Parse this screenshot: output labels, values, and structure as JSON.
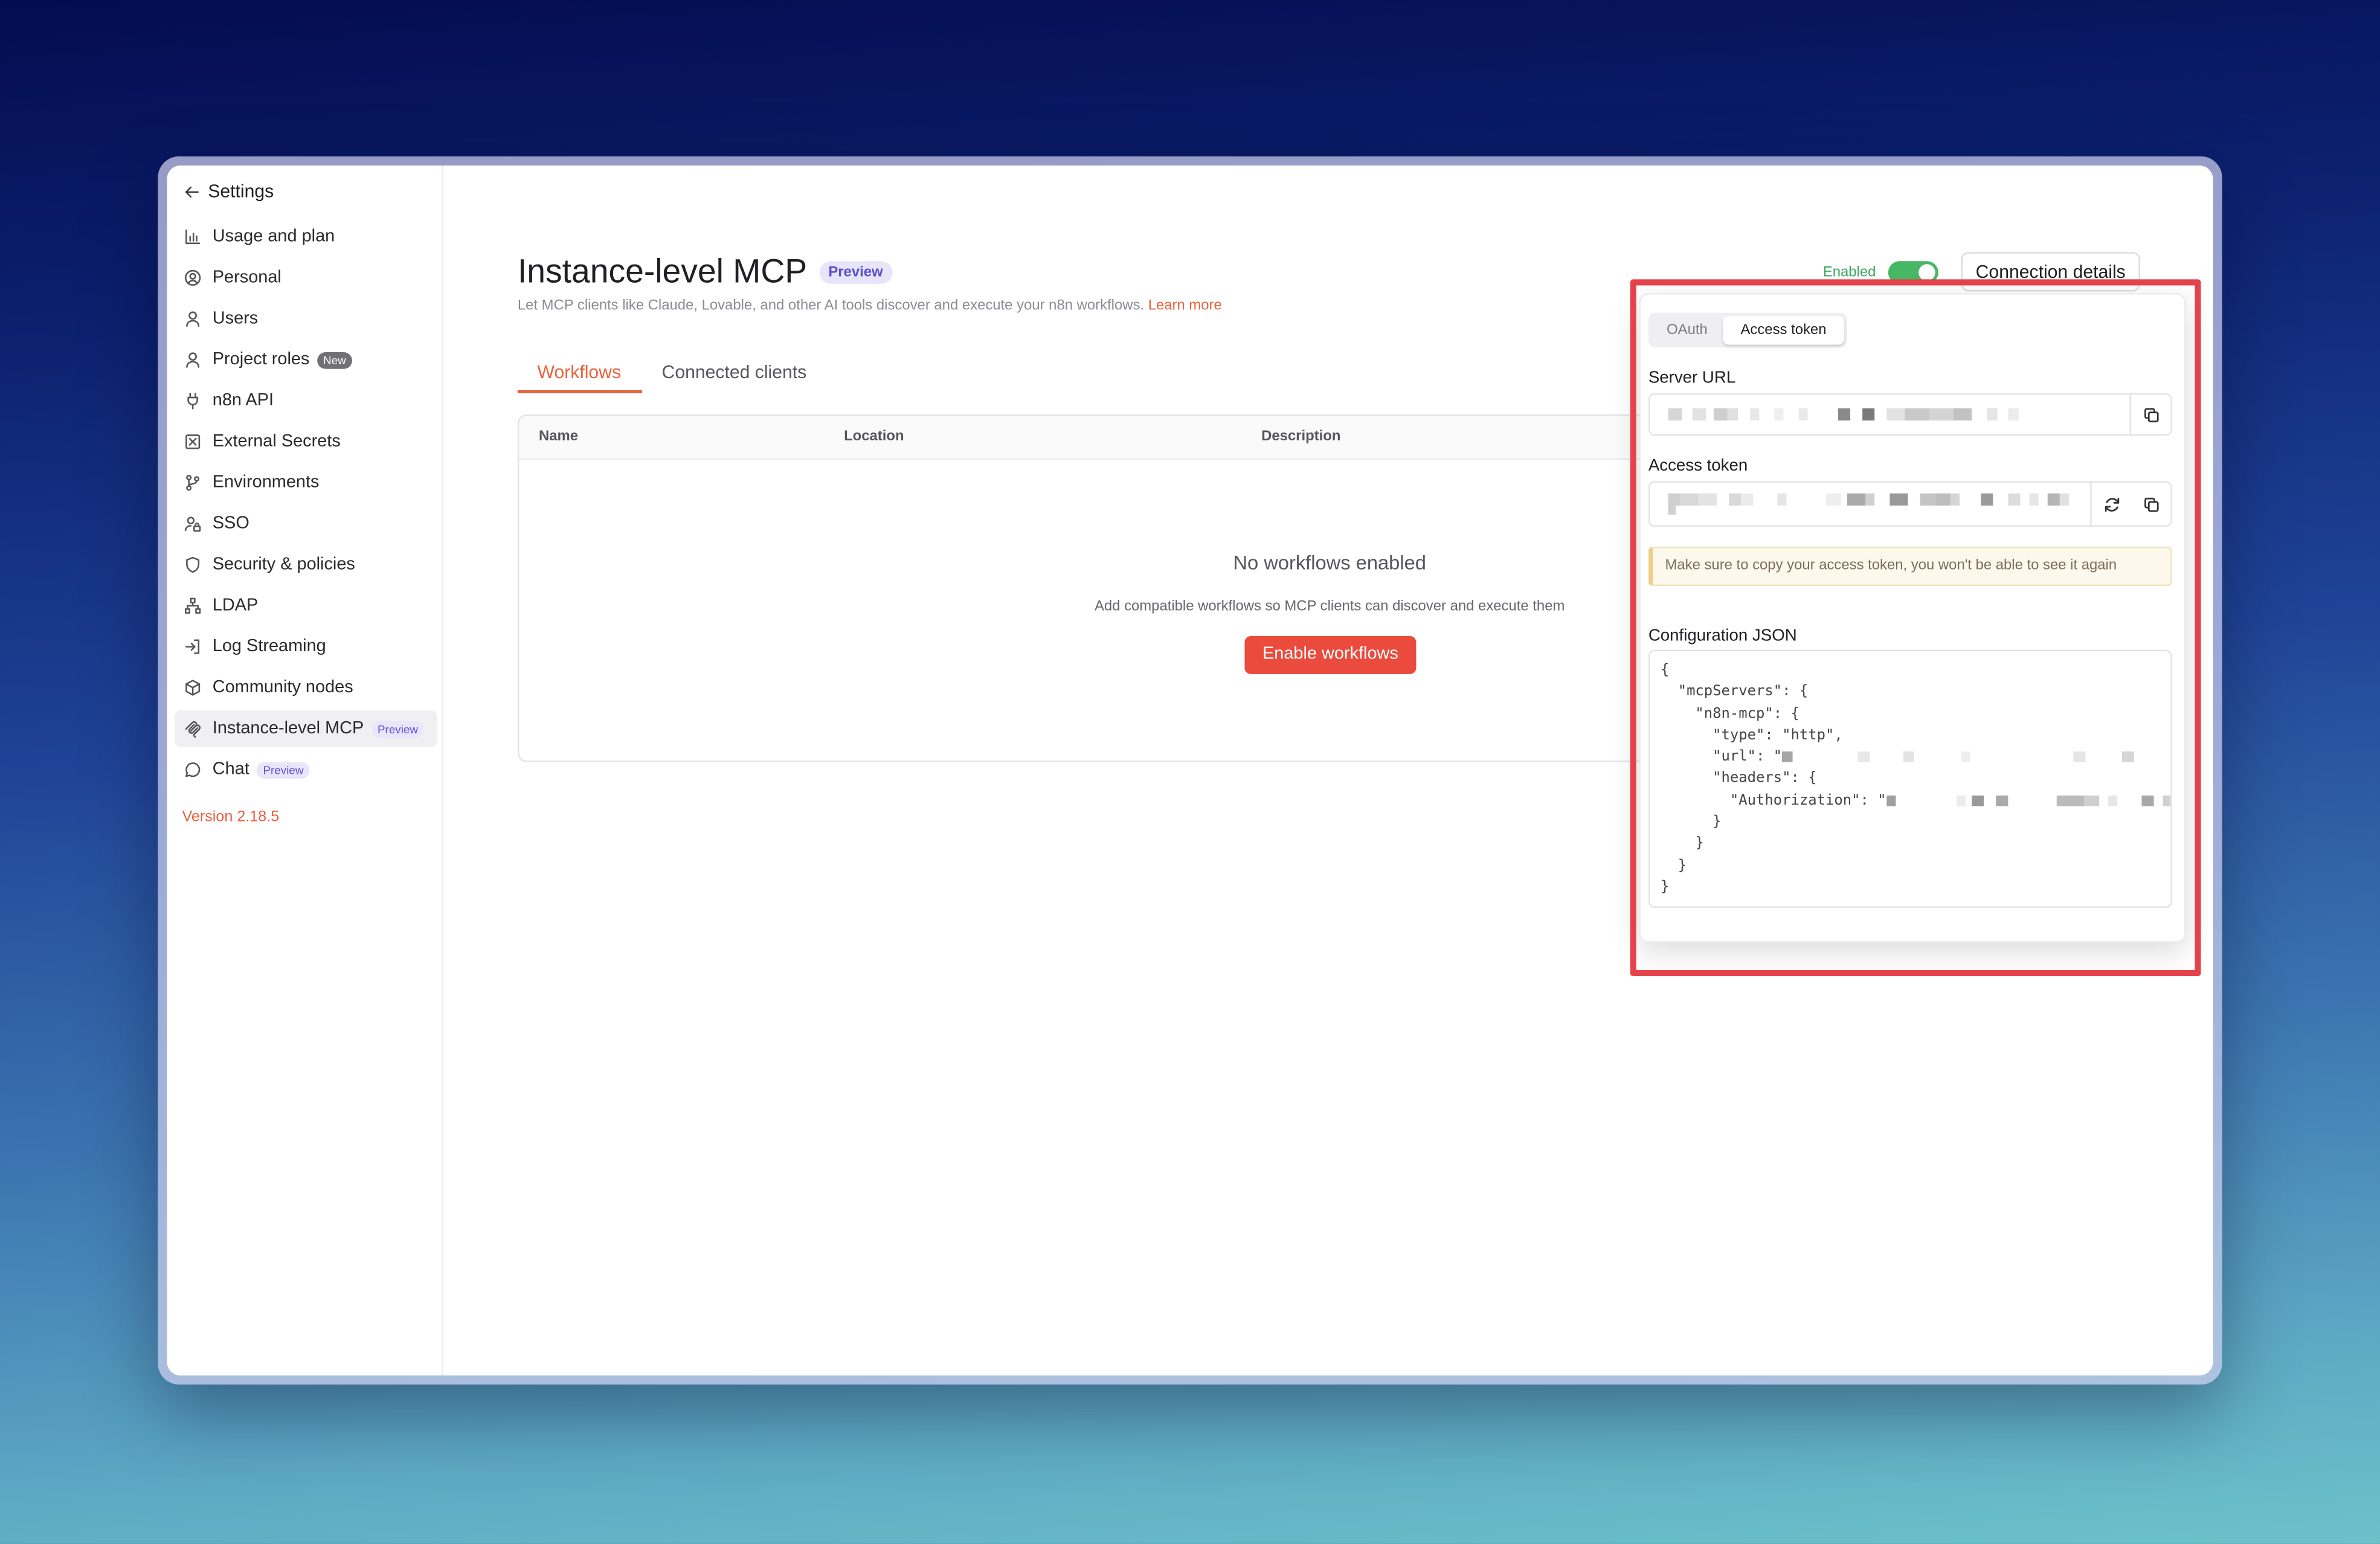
{
  "sidebar": {
    "back_label": "Settings",
    "back_icon": "arrow-left-icon",
    "items": [
      {
        "label": "Usage and plan",
        "icon": "chart-bar-icon"
      },
      {
        "label": "Personal",
        "icon": "user-circle-icon"
      },
      {
        "label": "Users",
        "icon": "user-icon"
      },
      {
        "label": "Project roles",
        "icon": "user-icon",
        "badge": "New"
      },
      {
        "label": "n8n API",
        "icon": "plug-icon"
      },
      {
        "label": "External Secrets",
        "icon": "vault-icon"
      },
      {
        "label": "Environments",
        "icon": "git-branch-icon"
      },
      {
        "label": "SSO",
        "icon": "user-lock-icon"
      },
      {
        "label": "Security & policies",
        "icon": "shield-icon"
      },
      {
        "label": "LDAP",
        "icon": "network-icon"
      },
      {
        "label": "Log Streaming",
        "icon": "sign-in-icon"
      },
      {
        "label": "Community nodes",
        "icon": "cube-icon"
      },
      {
        "label": "Instance-level MCP",
        "icon": "mcp-icon",
        "badge": "Preview",
        "active": true
      },
      {
        "label": "Chat",
        "icon": "chat-icon",
        "badge": "Preview"
      }
    ],
    "version": "Version 2.18.5"
  },
  "header": {
    "title": "Instance-level MCP",
    "badge": "Preview",
    "description": "Let MCP clients like Claude, Lovable, and other AI tools discover and execute your n8n workflows.",
    "learn_more": "Learn more",
    "enabled_label": "Enabled",
    "enabled": true,
    "connection_button": "Connection details"
  },
  "tabs": [
    {
      "label": "Workflows",
      "active": true
    },
    {
      "label": "Connected clients",
      "active": false
    }
  ],
  "table": {
    "columns": [
      "Name",
      "Location",
      "Description"
    ],
    "empty_title": "No workflows enabled",
    "empty_text": "Add compatible workflows so MCP clients can discover and execute them",
    "empty_button": "Enable workflows"
  },
  "connection_panel": {
    "auth_tabs": [
      {
        "label": "OAuth",
        "active": false
      },
      {
        "label": "Access token",
        "active": true
      }
    ],
    "server_url_label": "Server URL",
    "access_token_label": "Access token",
    "warning": "Make sure to copy your access token, you won't be able to see it again",
    "config_label": "Configuration JSON",
    "config_lines": [
      "{",
      "  \"mcpServers\": {",
      "    \"n8n-mcp\": {",
      "      \"type\": \"http\",",
      "      \"url\": \"",
      "      \"headers\": {",
      "        \"Authorization\": \"",
      "      }",
      "    }",
      "  }",
      "}"
    ],
    "icons": [
      "copy-icon",
      "refresh-icon"
    ]
  },
  "colors": {
    "accent": "#ea4b3d",
    "enabled_green": "#46b864",
    "preview_badge": "#5b4fcf",
    "highlight": "#e4434b"
  }
}
